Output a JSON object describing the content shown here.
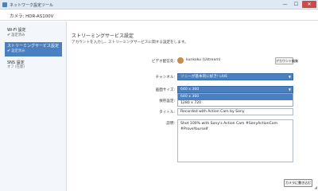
{
  "window": {
    "title": "ネットワーク設定ツール",
    "minimize": "—",
    "maximize": "☐",
    "close": "✕"
  },
  "header": {
    "camera_label": "カメラ: HDR-AS100V"
  },
  "sidebar": {
    "items": [
      {
        "title": "Wi-Fi 設定",
        "sub": "設定済み",
        "check": "✔",
        "selected": false
      },
      {
        "title": "ストリーミングサービス設定",
        "sub": "設定済み",
        "check": "✔",
        "selected": true
      },
      {
        "title": "SNS 設定",
        "sub": "オフ (任意)",
        "check": "",
        "selected": false
      }
    ]
  },
  "main": {
    "section_title": "ストリーミングサービス設定",
    "section_desc": "アカウントを入力し、ストリーミングサービスに関する設定をします。",
    "account": {
      "label": "ビデオ配信先:",
      "name": "kunkoku (Ustream)",
      "button": "アカウント編集"
    },
    "channel": {
      "label": "チャンネル:",
      "value": "ソニーが基本的に好き! LIVE",
      "arrow": "▼"
    },
    "size": {
      "label": "画面サイズ:",
      "value": "640 x 360",
      "arrow": "▼",
      "options": [
        "640 x 360",
        "1280 x 720"
      ]
    },
    "storage": {
      "label": "保存設定:"
    },
    "title": {
      "label": "タイトル:",
      "value": "Recorded with Action Cam by Sony"
    },
    "description": {
      "label": "説明:",
      "lines": [
        "Shot 100% with Sony's Action Cam #SonyActionCam",
        "#ProveYourself"
      ]
    },
    "cancel_button": "カメラに書き込む"
  },
  "colors": {
    "accent": "#4a7fc0",
    "titlebar": "#dfe9f5",
    "close": "#c94c4c"
  }
}
